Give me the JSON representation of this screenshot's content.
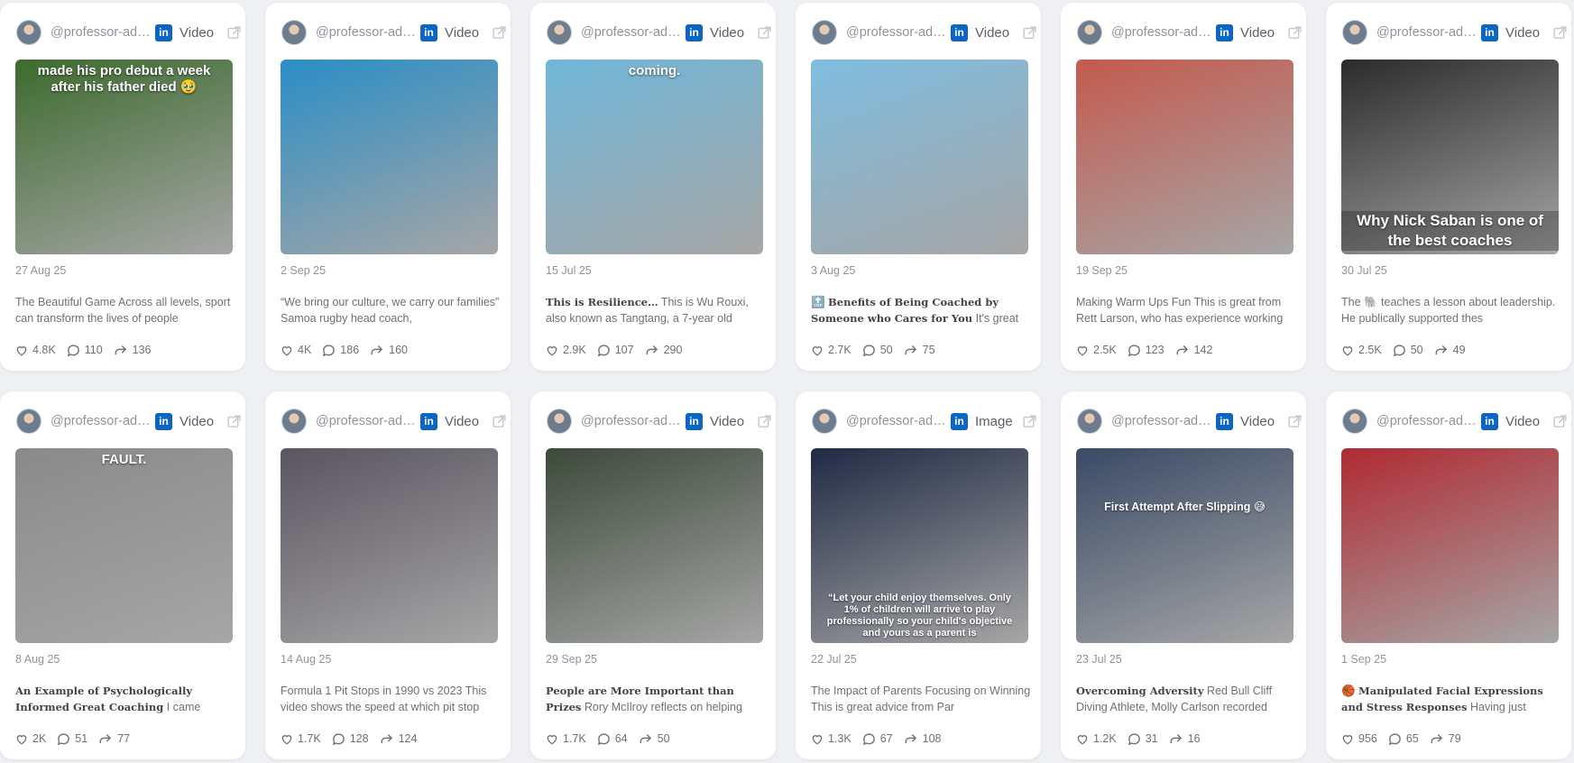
{
  "handle": "@professor-adam-nicholls",
  "cards": [
    {
      "type": "Video",
      "date": "27 Aug 25",
      "bold": "",
      "text": "The Beautiful Game Across all levels, sport can transform the lives of people",
      "likes": "4.8K",
      "comments": "110",
      "reposts": "136",
      "overlay": "made his pro debut a week after his father died 🥹",
      "overlay_pos": "top",
      "thumb_icon": "football-match-thumbnail"
    },
    {
      "type": "Video",
      "date": "2 Sep 25",
      "bold": "",
      "text": "“We bring our culture, we carry our families” Samoa rugby head coach,",
      "likes": "4K",
      "comments": "186",
      "reposts": "160",
      "overlay": "",
      "overlay_pos": "",
      "thumb_icon": "press-conference-thumbnail"
    },
    {
      "type": "Video",
      "date": "15 Jul 25",
      "bold": "This is Resilience…",
      "text": " This is Wu Rouxi, also known as Tangtang, a 7-year old",
      "likes": "2.9K",
      "comments": "107",
      "reposts": "290",
      "overlay": "coming.",
      "overlay_pos": "top",
      "thumb_icon": "skating-race-thumbnail"
    },
    {
      "type": "Video",
      "date": "3 Aug 25",
      "bold": "Benefits of Being Coached by Someone who Cares for You",
      "text": " It's great to see how",
      "likes": "2.7K",
      "comments": "50",
      "reposts": "75",
      "overlay": "",
      "overlay_pos": "",
      "thumb_icon": "gymnastics-thumbnail",
      "prefix": "🔝 "
    },
    {
      "type": "Video",
      "date": "19 Sep 25",
      "bold": "",
      "text": "Making Warm Ups Fun This is great from Rett Larson, who has experience working",
      "likes": "2.5K",
      "comments": "123",
      "reposts": "142",
      "overlay": "",
      "overlay_pos": "",
      "thumb_icon": "volleyball-court-thumbnail"
    },
    {
      "type": "Video",
      "date": "30 Jul 25",
      "bold": "",
      "text": "The 🐘 teaches a lesson about leadership. He publically supported thes",
      "likes": "2.5K",
      "comments": "50",
      "reposts": "49",
      "overlay": "Why Nick Saban is one of the best coaches",
      "overlay_pos": "bottom",
      "thumb_icon": "championship-presser-thumbnail"
    },
    {
      "type": "Video",
      "date": "8 Aug 25",
      "bold": "An Example of Psychologically Informed Great Coaching",
      "text": " I came across this",
      "likes": "2K",
      "comments": "51",
      "reposts": "77",
      "overlay": "FAULT.",
      "overlay_pos": "top",
      "thumb_icon": "basketball-coach-thumbnail"
    },
    {
      "type": "Video",
      "date": "14 Aug 25",
      "bold": "",
      "text": "Formula 1 Pit Stops in 1990 vs 2023 This video shows the speed at which pit stop",
      "likes": "1.7K",
      "comments": "128",
      "reposts": "124",
      "overlay": "",
      "overlay_pos": "",
      "thumb_icon": "pit-stop-thumbnail"
    },
    {
      "type": "Video",
      "date": "29 Sep 25",
      "bold": "People are More Important than Prizes",
      "text": " Rory McIlroy reflects on helping Europe at The",
      "likes": "1.7K",
      "comments": "64",
      "reposts": "50",
      "overlay": "",
      "overlay_pos": "",
      "thumb_icon": "golfer-portrait-thumbnail"
    },
    {
      "type": "Image",
      "date": "22 Jul 25",
      "bold": "",
      "text": "The Impact of Parents Focusing on Winning This is great advice from Par",
      "likes": "1.3K",
      "comments": "67",
      "reposts": "108",
      "overlay": "“Let your child enjoy themselves. Only 1% of children will arrive to play professionally so your child's objective and yours as a parent is",
      "overlay_pos": "bottom-small",
      "thumb_icon": "football-coach-quote-thumbnail"
    },
    {
      "type": "Video",
      "date": "23 Jul 25",
      "bold": "Overcoming Adversity",
      "text": " Red Bull Cliff Diving Athlete, Molly Carlson recorded footage",
      "likes": "1.2K",
      "comments": "31",
      "reposts": "16",
      "overlay": "First Attempt After Slipping 😅",
      "overlay_pos": "middle",
      "thumb_icon": "cliff-diving-thumbnail"
    },
    {
      "type": "Video",
      "date": "1 Sep 25",
      "bold": "Manipulated Facial Expressions and Stress Responses",
      "text": " Having just watched th",
      "likes": "956",
      "comments": "65",
      "reposts": "79",
      "overlay": "",
      "overlay_pos": "",
      "thumb_icon": "basketball-player-thumbnail",
      "prefix": "🏀 "
    }
  ],
  "thumb_colors": [
    "#3d6b2e",
    "#2a8ec6",
    "#6fb6d8",
    "#7fbde0",
    "#c45a4e",
    "#2b2b2b",
    "#8a8a8a",
    "#5a5560",
    "#3c4a3a",
    "#1f2a44",
    "#3a4a66",
    "#b02a32"
  ]
}
